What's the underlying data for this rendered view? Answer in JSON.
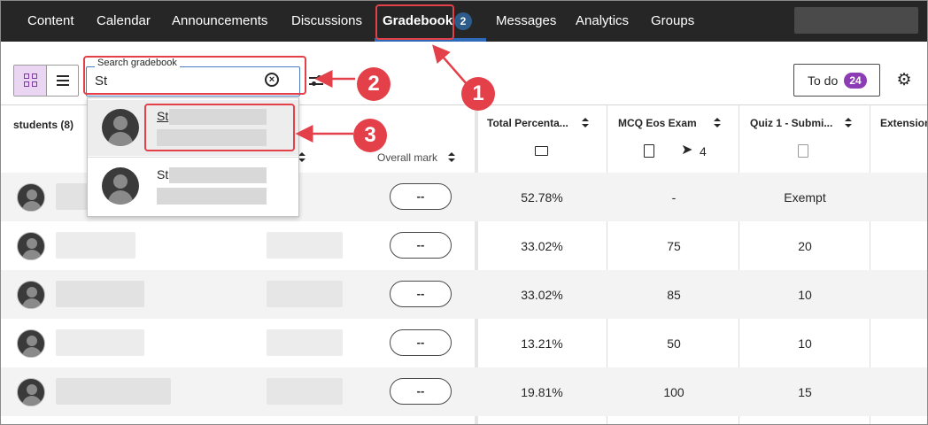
{
  "nav": {
    "items": [
      "Content",
      "Calendar",
      "Announcements",
      "Discussions",
      "Gradebook",
      "Messages",
      "Analytics",
      "Groups"
    ],
    "active": "Gradebook",
    "gradebook_badge": "2"
  },
  "toolbar": {
    "search_legend": "Search gradebook",
    "search_value": "St",
    "todo_label": "To do",
    "todo_count": "24",
    "clear_glyph": "⊗",
    "gear_glyph": "⚙"
  },
  "columns": {
    "students": "students (8)",
    "overall": "Overall mark",
    "total": "Total Percenta...",
    "mcq": "MCQ Eos Exam",
    "mcq_count": "4",
    "quiz": "Quiz 1 - Submi...",
    "ext": "Extension"
  },
  "rows": [
    {
      "mark": "--",
      "total": "52.78%",
      "mcq": "-",
      "quiz": "Exempt"
    },
    {
      "mark": "--",
      "total": "33.02%",
      "mcq": "75",
      "quiz": "20"
    },
    {
      "mark": "--",
      "total": "33.02%",
      "mcq": "85",
      "quiz": "10"
    },
    {
      "mark": "--",
      "total": "13.21%",
      "mcq": "50",
      "quiz": "10"
    },
    {
      "mark": "--",
      "total": "19.81%",
      "mcq": "100",
      "quiz": "15"
    }
  ],
  "dropdown": {
    "items": [
      {
        "name_prefix": "St"
      },
      {
        "name_prefix": "St"
      }
    ]
  },
  "annotations": {
    "labels": [
      "1",
      "2",
      "3"
    ],
    "color": "#e3404a"
  },
  "colors": {
    "nav_bg": "#262626",
    "active_underline": "#2e6ab8",
    "todo_badge": "#8c3cb4",
    "view_toggle_active": "#ead6f2"
  }
}
